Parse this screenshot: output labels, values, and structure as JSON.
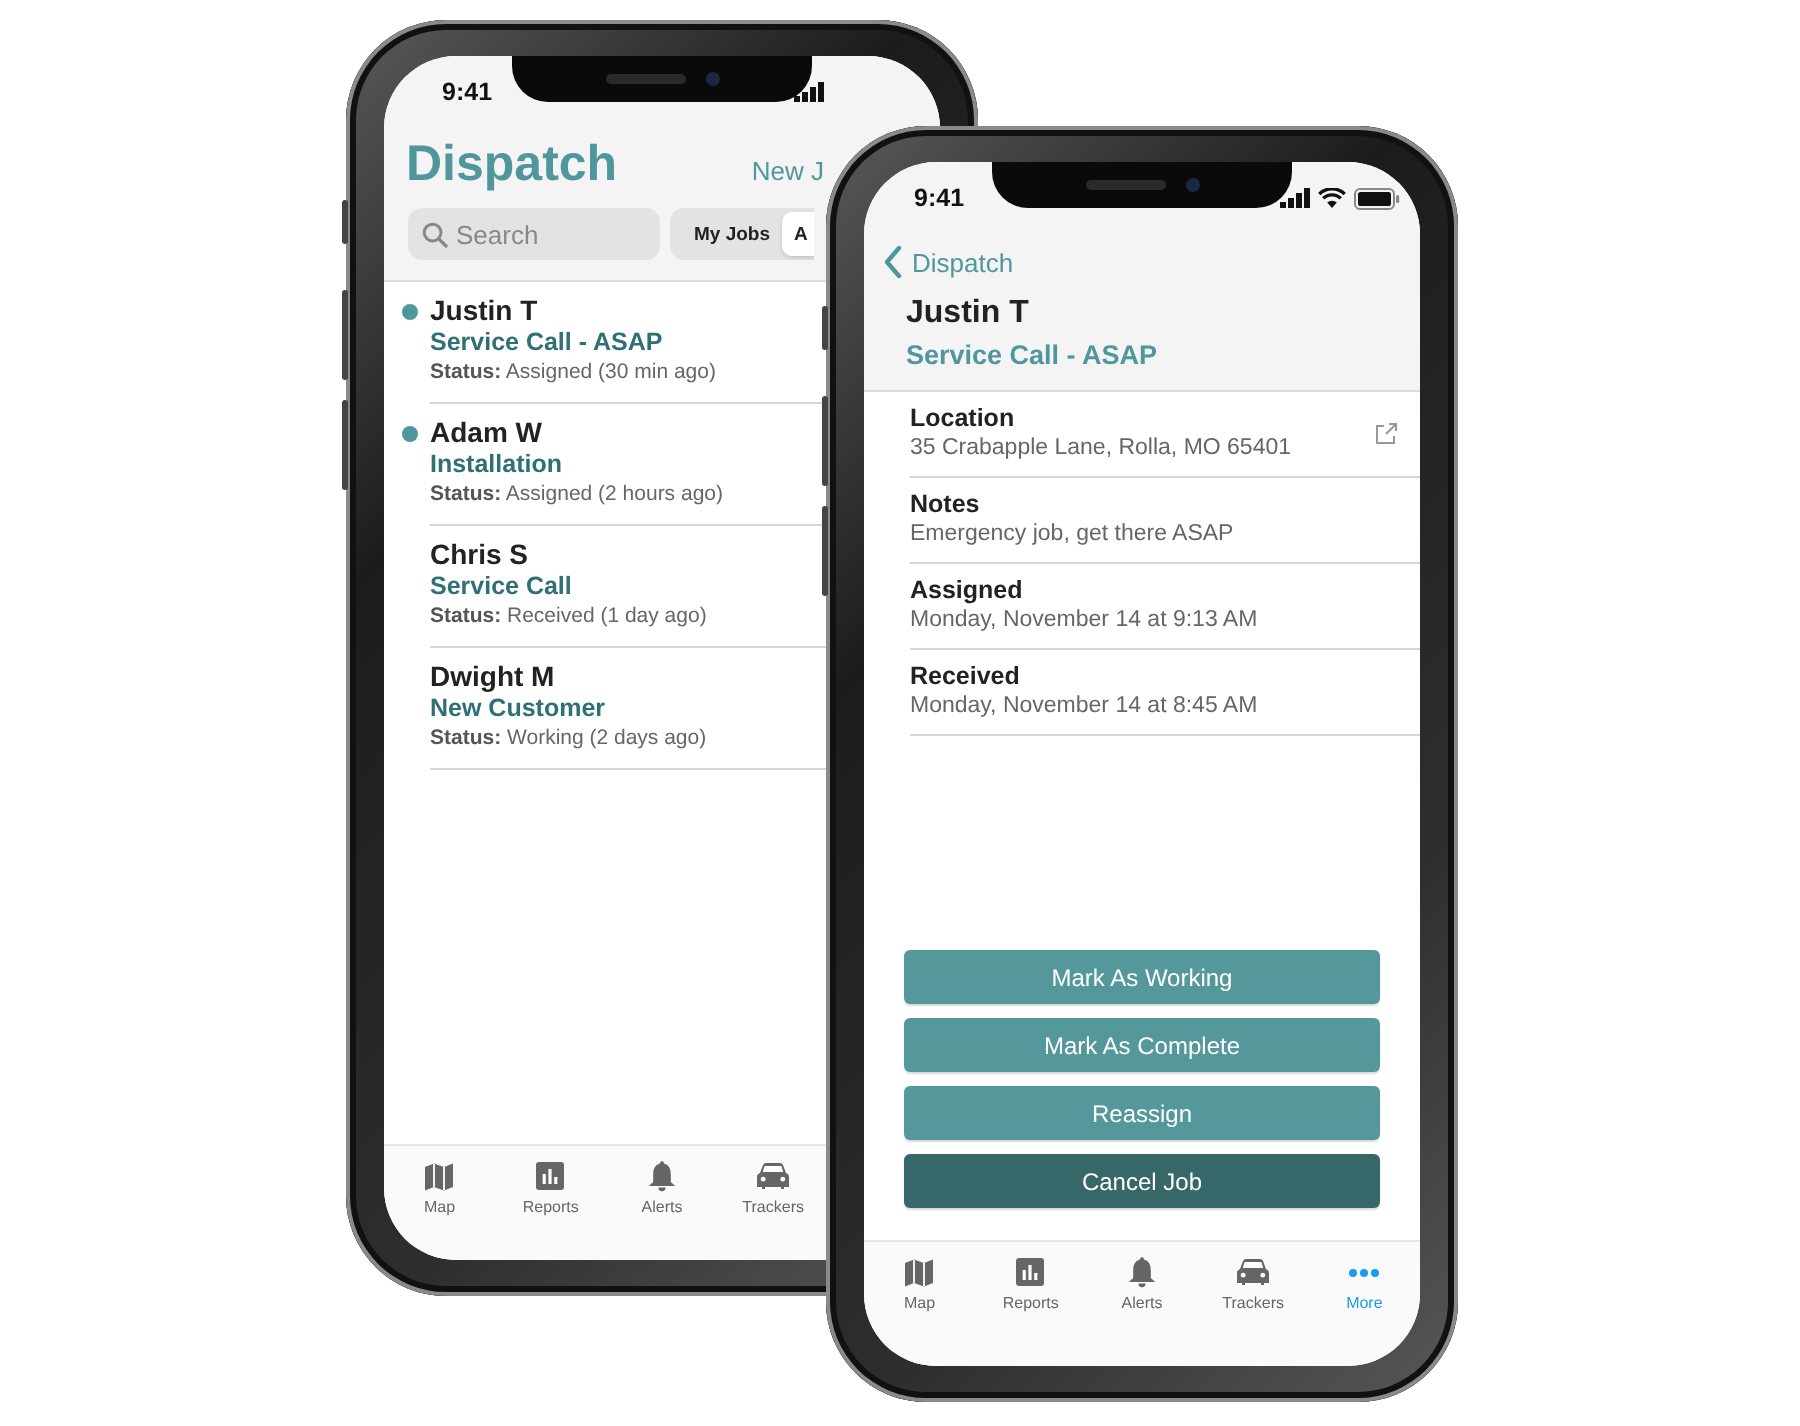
{
  "phones": [
    {
      "kind": "list",
      "status_time": "9:41",
      "title": "Dispatch",
      "action": "New J",
      "search": {
        "placeholder": "Search"
      },
      "segments": [
        {
          "label": "My Jobs",
          "selected": false
        },
        {
          "label": "A",
          "selected": true
        }
      ],
      "jobs": [
        {
          "name": "Justin T",
          "job_type": "Service Call - ASAP",
          "status": "**Status:** Assigned (30 min ago)",
          "unread": true
        },
        {
          "name": "Adam W",
          "job_type": "Installation",
          "status": "**Status:** Assigned (2 hours ago)",
          "unread": true
        },
        {
          "name": "Chris S",
          "job_type": "Service Call",
          "status": "**Status:** Received (1 day ago)",
          "unread": false
        },
        {
          "name": "Dwight M",
          "job_type": "New Customer",
          "status": "**Status:** Working (2 days ago)",
          "unread": false
        }
      ],
      "tab_bar": [
        {
          "label": "Map",
          "selected": false
        },
        {
          "label": "Reports",
          "selected": false
        },
        {
          "label": "Alerts",
          "selected": false
        },
        {
          "label": "Trackers",
          "selected": false
        }
      ]
    },
    {
      "kind": "detail",
      "status_time": "9:41",
      "back": "Dispatch",
      "name": "Justin T",
      "job_type": "Service Call - ASAP",
      "fields": [
        {
          "label": "Location",
          "value": "35 Crabapple Lane, Rolla, MO 65401",
          "kind": "link"
        },
        {
          "label": "Notes",
          "value": "Emergency job, get there ASAP",
          "kind": "text"
        },
        {
          "label": "Assigned",
          "value": "Monday, November 14 at 9:13 AM",
          "kind": "text"
        },
        {
          "label": "Received",
          "value": "Monday, November 14 at 8:45 AM",
          "kind": "text"
        }
      ],
      "actions": [
        {
          "label": "Mark As Working",
          "kind": "primary"
        },
        {
          "label": "Mark As Complete",
          "kind": "primary"
        },
        {
          "label": "Reassign",
          "kind": "primary"
        },
        {
          "label": "Cancel Job",
          "kind": "danger"
        }
      ],
      "tab_bar": [
        {
          "label": "Map",
          "selected": false
        },
        {
          "label": "Reports",
          "selected": false
        },
        {
          "label": "Alerts",
          "selected": false
        },
        {
          "label": "Trackers",
          "selected": false
        },
        {
          "label": "More",
          "selected": true
        }
      ]
    }
  ]
}
